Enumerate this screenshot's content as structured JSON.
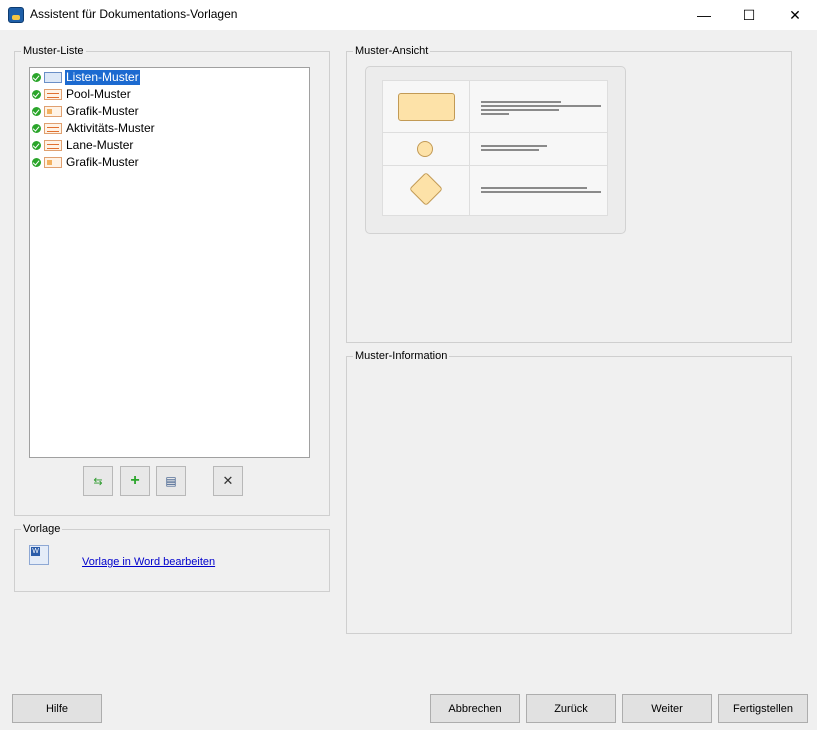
{
  "window": {
    "title": "Assistent für Dokumentations-Vorlagen",
    "minimize_glyph": "—",
    "maximize_glyph": "☐",
    "close_glyph": "✕"
  },
  "muster_liste": {
    "label": "Muster-Liste",
    "items": [
      {
        "label": "Listen-Muster",
        "icon": "list-pattern-icon",
        "selected": true
      },
      {
        "label": "Pool-Muster",
        "icon": "pool-pattern-icon",
        "selected": false
      },
      {
        "label": "Grafik-Muster",
        "icon": "graphic-pattern-icon",
        "selected": false
      },
      {
        "label": "Aktivitäts-Muster",
        "icon": "activity-pattern-icon",
        "selected": false
      },
      {
        "label": "Lane-Muster",
        "icon": "lane-pattern-icon",
        "selected": false
      },
      {
        "label": "Grafik-Muster",
        "icon": "graphic-pattern-icon",
        "selected": false
      }
    ],
    "toolbar": {
      "refresh_glyph": "⇆",
      "add_glyph": "+",
      "edit_glyph": "▤",
      "delete_glyph": "✕"
    }
  },
  "vorlage": {
    "label": "Vorlage",
    "link_text": "Vorlage in Word bearbeiten"
  },
  "muster_ansicht": {
    "label": "Muster-Ansicht"
  },
  "muster_information": {
    "label": "Muster-Information"
  },
  "buttons": {
    "help": "Hilfe",
    "cancel": "Abbrechen",
    "back": "Zurück",
    "next": "Weiter",
    "finish": "Fertigstellen"
  },
  "colors": {
    "selection": "#1c6ad0",
    "link": "#0000cc",
    "shape_fill": "#fde2a8",
    "check_green": "#2aa52a"
  }
}
